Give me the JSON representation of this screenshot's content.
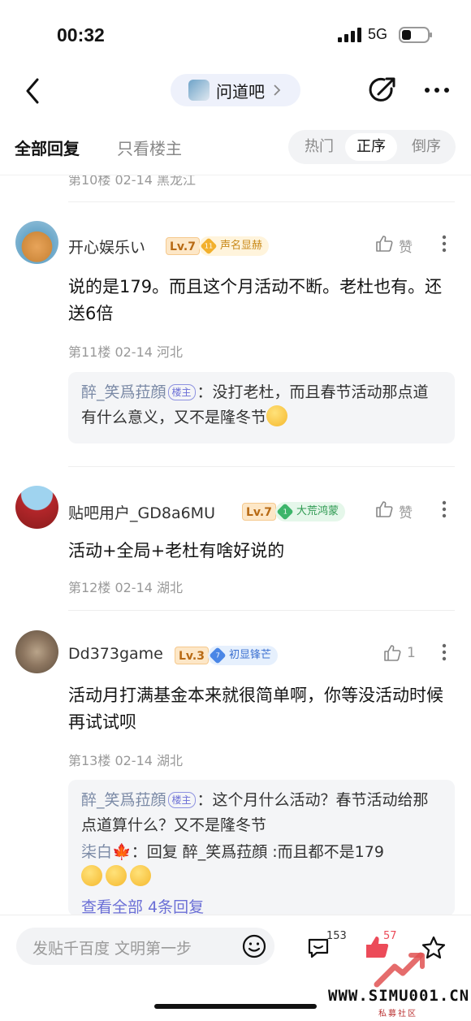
{
  "status": {
    "time": "00:32",
    "network": "5G"
  },
  "header": {
    "bar_name": "问道吧"
  },
  "tabs": {
    "all": "全部回复",
    "owner_only": "只看楼主",
    "sort": [
      "热门",
      "正序",
      "倒序"
    ],
    "sort_selected": "正序"
  },
  "prev_floor_meta": "第10楼  02-14  黑龙江",
  "posts": [
    {
      "username": "开心娱乐い",
      "level": "Lv.7",
      "badge_num": "11",
      "badge": "声名显赫",
      "like_label": "赞",
      "content": "说的是179。而且这个月活动不断。老杜也有。还送6倍",
      "meta": "第11楼  02-14  河北",
      "replies": [
        {
          "name": "醉_笑爲菈顔",
          "tag": "楼主",
          "text": "：没打老杜，而且春节活动那点道有什么意义，又不是隆冬节"
        }
      ]
    },
    {
      "username": "贴吧用户_GD8a6MU",
      "level": "Lv.7",
      "badge_num": "1",
      "badge": "大荒鸿蒙",
      "like_label": "赞",
      "content": "活动+全局+老杜有啥好说的",
      "meta": "第12楼  02-14  湖北"
    },
    {
      "username": "Dd373game",
      "level": "Lv.3",
      "badge_num": "7",
      "badge": "初显锋芒",
      "like_label": "1",
      "content": "活动月打满基金本来就很简单啊，你等没活动时候再试试呗",
      "meta": "第13楼  02-14  湖北",
      "replies": [
        {
          "name": "醉_笑爲菈顔",
          "tag": "楼主",
          "text": "：这个月什么活动？春节活动给那点道算什么？又不是隆冬节"
        },
        {
          "name": "柒白",
          "tag": "",
          "text": "：回复 醉_笑爲菈顔 :而且都不是179"
        }
      ],
      "more_replies": "查看全部 4条回复"
    }
  ],
  "bottom": {
    "input_placeholder": "发贴千百度 文明第一步",
    "comment_count": "153",
    "like_count": "57"
  },
  "watermark": {
    "site": "WWW.SIMU001.CN",
    "sub": "私募社区"
  },
  "colors": {
    "accent_blue": "#6b6fd6",
    "like_red": "#ec4b59",
    "level_orange": "#b86a14"
  }
}
